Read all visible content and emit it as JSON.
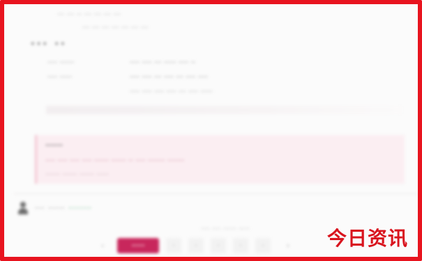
{
  "header": {
    "note_line1": "··· ··· ·· ··· ··· ··· ···",
    "note_line2": "··· ··· ··· ··· ··· ··· ···"
  },
  "section": {
    "title": "··· ··"
  },
  "details": [
    {
      "label": "···· ······",
      "value": "···· ···· ··· ····· ···· ··"
    },
    {
      "label": "···· ·····",
      "value": "···· ···· ··· ···· ··· ···· ····"
    },
    {
      "label": "",
      "value": "···· ···· ···· ···· ··· ···· ·····"
    }
  ],
  "alert": {
    "title": "······",
    "body_line1": "···· ···· ···· ···· ······ ······ ·· ···· ······· ·······",
    "body_line2": "······ ······ ······ ·····"
  },
  "user": {
    "label": "··· ·····",
    "handle": "·······"
  },
  "pager": {
    "caption": "···· ···· ······ ·····",
    "prev": "‹",
    "current": "·····",
    "pages": [
      "·",
      "·",
      "·",
      "·",
      "·"
    ],
    "next": "›"
  },
  "watermark": {
    "text": "今日资讯"
  },
  "colors": {
    "frame": "#e8141f",
    "accent_pink": "#c8275c",
    "alert_bg": "#fbeef2",
    "green": "#3fa36a"
  }
}
